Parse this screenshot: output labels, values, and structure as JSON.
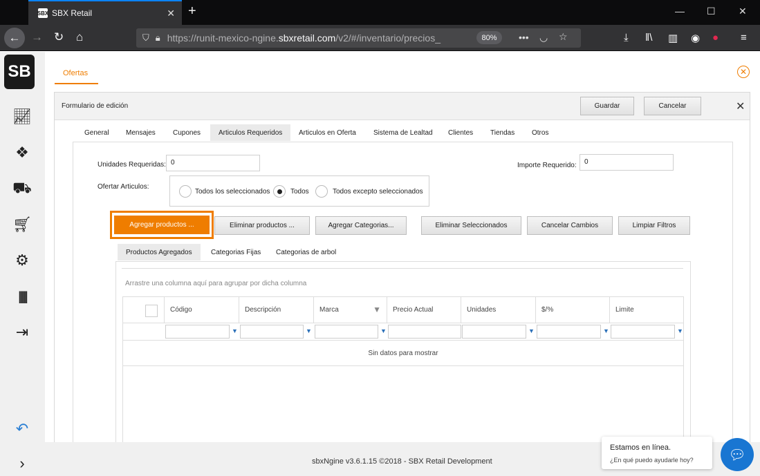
{
  "browser": {
    "tab_title": "SBX Retail",
    "tab_favicon": "SBX",
    "url_prefix": "https://runit-mexico-ngine.",
    "url_domain": "sbxretail.com",
    "url_suffix": "/v2/#/inventario/precios_",
    "zoom": "80%"
  },
  "sidebar": {
    "logo": "SB"
  },
  "page": {
    "section_tab": "Ofertas",
    "form_title": "Formulario de edición",
    "save_label": "Guardar",
    "cancel_label": "Cancelar"
  },
  "tabs": [
    "General",
    "Mensajes",
    "Cupones",
    "Articulos Requeridos",
    "Articulos en Oferta",
    "Sistema de Lealtad",
    "Clientes",
    "Tiendas",
    "Otros"
  ],
  "fields": {
    "unidades_label": "Unidades Requeridas:",
    "unidades_value": "0",
    "importe_label": "Importe Requerido:",
    "importe_value": "0",
    "ofertar_label": "Ofertar Articulos:",
    "radio_options": [
      "Todos los seleccionados",
      "Todos",
      "Todos excepto seleccionados"
    ],
    "radio_selected": "Todos"
  },
  "actions": [
    "Agregar productos ...",
    "Eliminar productos ...",
    "Agregar Categorias...",
    "Eliminar Seleccionados",
    "Cancelar Cambios",
    "Limpiar Filtros"
  ],
  "grid_tabs": [
    "Productos Agregados",
    "Categorias Fijas",
    "Categorias de arbol"
  ],
  "grid": {
    "group_hint": "Arrastre una columna aquí para agrupar por dicha columna",
    "columns": [
      "Código",
      "Descripción",
      "Marca",
      "Precio Actual",
      "Unidades",
      "$/%",
      "Limite"
    ],
    "empty_text": "Sin datos para mostrar"
  },
  "footer": {
    "text": "sbxNgine v3.6.1.15 ©2018 - SBX Retail Development"
  },
  "chat": {
    "title": "Estamos en línea.",
    "subtitle": "¿En qué puedo ayudarle hoy?"
  },
  "colors": {
    "accent": "#ef7d00",
    "chat": "#1976d2"
  }
}
